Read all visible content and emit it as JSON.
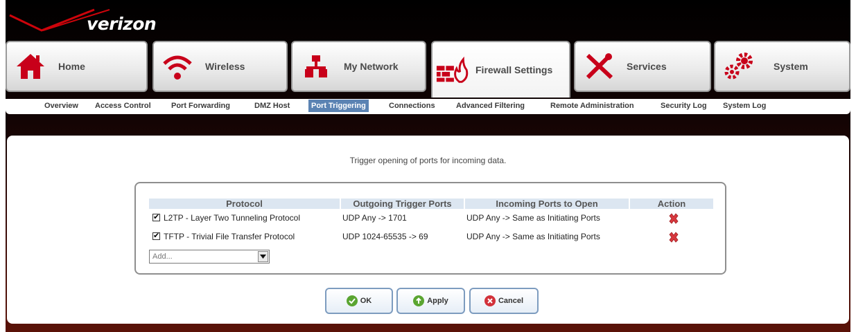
{
  "brand": {
    "logo_text": "verizon",
    "accent": "#cd040b"
  },
  "tabs": [
    {
      "label": "Home",
      "icon": "house-icon"
    },
    {
      "label": "Wireless",
      "icon": "wifi-icon"
    },
    {
      "label": "My Network",
      "icon": "network-icon"
    },
    {
      "label": "Firewall Settings",
      "icon": "firewall-icon",
      "active": true
    },
    {
      "label": "Services",
      "icon": "tools-icon"
    },
    {
      "label": "System",
      "icon": "gears-icon"
    }
  ],
  "subnav": [
    {
      "label": "Overview"
    },
    {
      "label": "Access Control"
    },
    {
      "label": "Port Forwarding"
    },
    {
      "label": "DMZ Host"
    },
    {
      "label": "Port Triggering",
      "active": true
    },
    {
      "label": "Connections"
    },
    {
      "label": "Advanced Filtering"
    },
    {
      "label": "Remote Administration"
    },
    {
      "label": "Security Log"
    },
    {
      "label": "System Log"
    }
  ],
  "main": {
    "intro": "Trigger opening of ports for incoming data.",
    "table": {
      "headers": [
        "Protocol",
        "Outgoing Trigger Ports",
        "Incoming Ports to Open",
        "Action"
      ],
      "rows": [
        {
          "checked": true,
          "protocol": "L2TP - Layer Two Tunneling Protocol",
          "outgoing": "UDP Any -> 1701",
          "incoming": "UDP Any -> Same as Initiating Ports"
        },
        {
          "checked": true,
          "protocol": "TFTP - Trivial File Transfer Protocol",
          "outgoing": "UDP 1024-65535 -> 69",
          "incoming": "UDP Any -> Same as Initiating Ports"
        }
      ]
    },
    "add_select": {
      "value": "Add..."
    }
  },
  "buttons": {
    "ok": "OK",
    "apply": "Apply",
    "cancel": "Cancel"
  }
}
